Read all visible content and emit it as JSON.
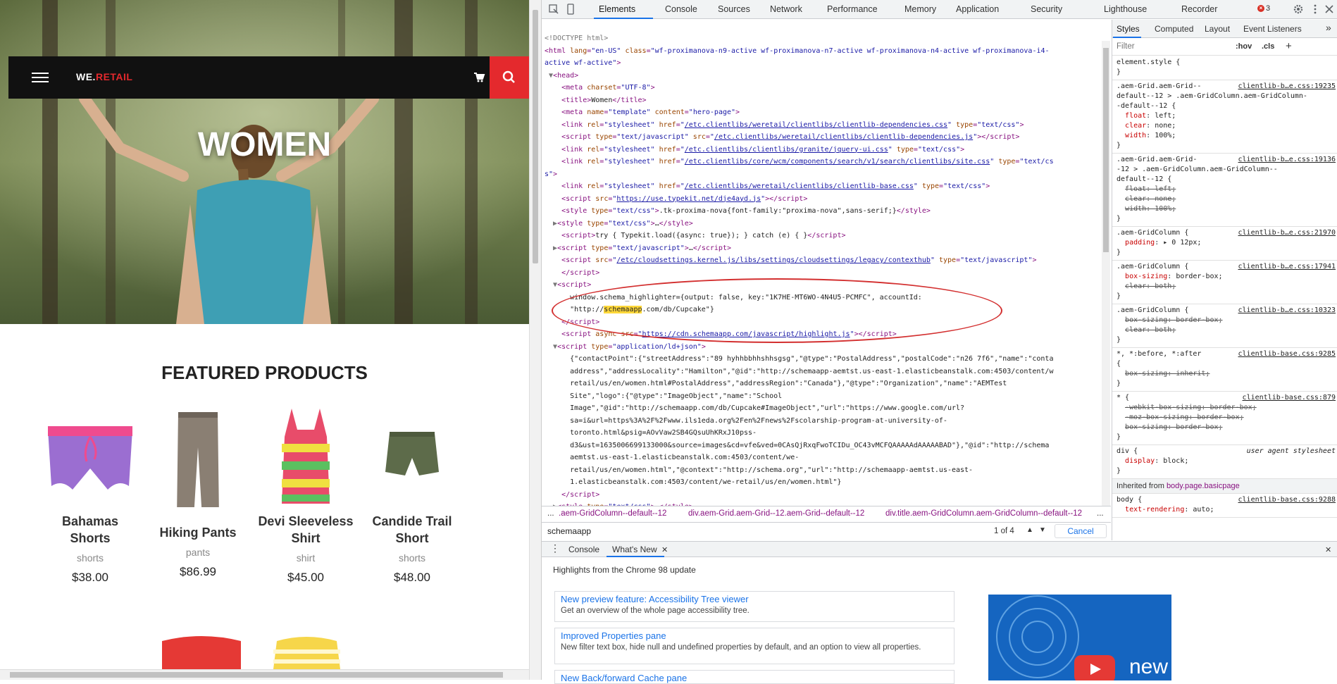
{
  "site": {
    "brand_a": "WE.",
    "brand_b": "RETAIL",
    "hero_title": "WOMEN",
    "featured_heading": "FEATURED PRODUCTS",
    "products": [
      {
        "name": "Bahamas Shorts",
        "category": "shorts",
        "price": "$38.00"
      },
      {
        "name": "Hiking Pants",
        "category": "pants",
        "price": "$86.99"
      },
      {
        "name": "Devi Sleeveless Shirt",
        "category": "shirt",
        "price": "$45.00"
      },
      {
        "name": "Candide Trail Short",
        "category": "shorts",
        "price": "$48.00"
      }
    ]
  },
  "devtools": {
    "tabs": [
      "Elements",
      "Console",
      "Sources",
      "Network",
      "Performance",
      "Memory",
      "Application",
      "Security",
      "Lighthouse",
      "Recorder"
    ],
    "error_count": "3",
    "styles_tabs": [
      "Styles",
      "Computed",
      "Layout",
      "Event Listeners"
    ],
    "filter_placeholder": "Filter",
    "filter_hov": ":hov",
    "filter_cls": ".cls",
    "breadcrumbs": [
      "...",
      ".aem-GridColumn--default--12",
      "div.aem-Grid.aem-Grid--12.aem-Grid--default--12",
      "div.title.aem-GridColumn.aem-GridColumn--default--12",
      "..."
    ],
    "search": {
      "value": "schemaapp",
      "count": "1 of 4",
      "cancel": "Cancel"
    },
    "drawer_tabs": [
      "Console",
      "What's New"
    ],
    "highlights": "Highlights from the Chrome 98 update",
    "news": [
      {
        "title": "New preview feature: Accessibility Tree viewer",
        "desc": "Get an overview of the whole page accessibility tree."
      },
      {
        "title": "Improved Properties pane",
        "desc": "New filter text box, hide null and undefined properties by default, and an option to view all properties."
      },
      {
        "title": "New Back/forward Cache pane",
        "desc": ""
      }
    ],
    "promo_text": "new",
    "inherited_label": "Inherited from",
    "inherited_from": "body.page.basicpage"
  },
  "colors": {
    "brand_red": "#e4292d",
    "devtools_accent": "#1a73e8",
    "annotation_ellipse": "#d32f2f",
    "search_highlight": "#ffd83a"
  }
}
